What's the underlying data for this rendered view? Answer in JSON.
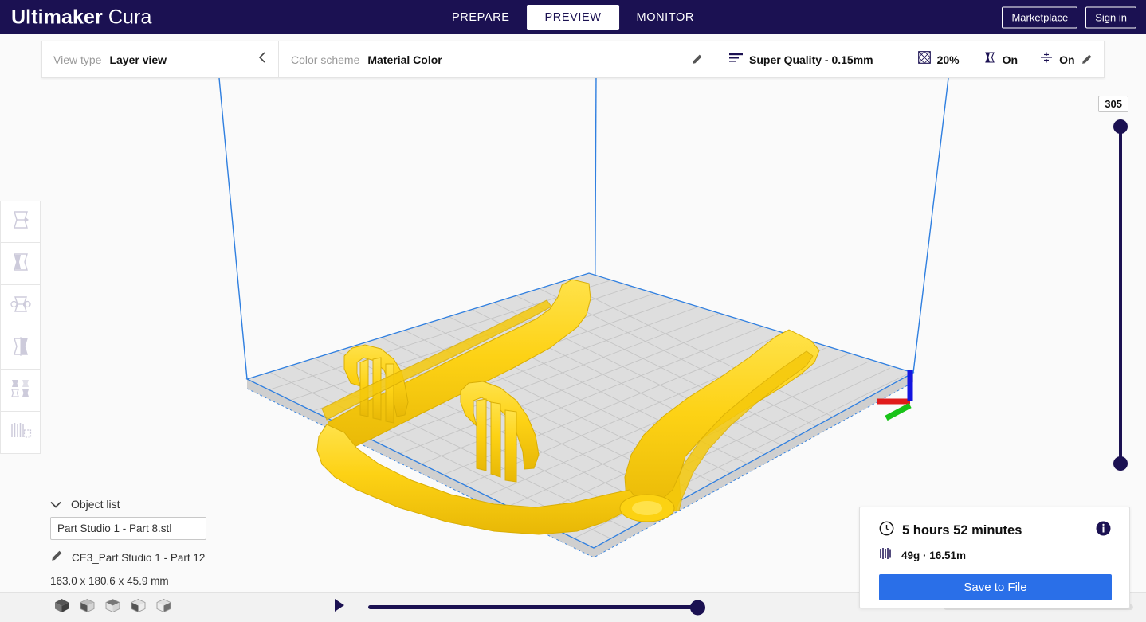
{
  "app": {
    "brand_bold": "Ultimaker",
    "brand_light": "Cura"
  },
  "header": {
    "tabs": [
      {
        "label": "PREPARE",
        "active": false
      },
      {
        "label": "PREVIEW",
        "active": true
      },
      {
        "label": "MONITOR",
        "active": false
      }
    ],
    "marketplace_label": "Marketplace",
    "signin_label": "Sign in",
    "background_color": "#1b1152"
  },
  "settings_bar": {
    "view_type_label": "View type",
    "view_type_value": "Layer view",
    "color_scheme_label": "Color scheme",
    "color_scheme_value": "Material Color",
    "quality_value": "Super Quality - 0.15mm",
    "infill_value": "20%",
    "support_value": "On",
    "adhesion_value": "On"
  },
  "toolbar": {
    "items": [
      {
        "name": "move-tool",
        "enabled": false
      },
      {
        "name": "scale-tool",
        "enabled": false
      },
      {
        "name": "rotate-tool",
        "enabled": false
      },
      {
        "name": "mirror-tool",
        "enabled": false
      },
      {
        "name": "per-model-settings-tool",
        "enabled": false
      },
      {
        "name": "support-blocker-tool",
        "enabled": false
      }
    ]
  },
  "object_list": {
    "title": "Object list",
    "selected_object": "Part Studio 1 - Part 8.stl",
    "printer_object": "CE3_Part Studio 1 - Part 12",
    "dimensions": "163.0 x 180.6 x 45.9 mm"
  },
  "print_info": {
    "time": "5 hours 52 minutes",
    "material": "49g · 16.51m",
    "save_label": "Save to File",
    "button_color": "#2a6fe8"
  },
  "layer_slider": {
    "value": "305",
    "color": "#1b1152"
  },
  "viewport": {
    "background_color": "#fafafa",
    "model_color": "#fcd212",
    "buildplate_color": "#dedede",
    "volume_line_color": "#2f7fe0",
    "axis_x_color": "#e01b1b",
    "axis_y_color": "#18c318",
    "axis_z_color": "#1414e0"
  },
  "bottom_bar": {
    "view_icons": [
      "view-3d-icon",
      "view-front-icon",
      "view-top-icon",
      "view-left-icon",
      "view-right-icon"
    ],
    "play_label": "play-icon"
  }
}
